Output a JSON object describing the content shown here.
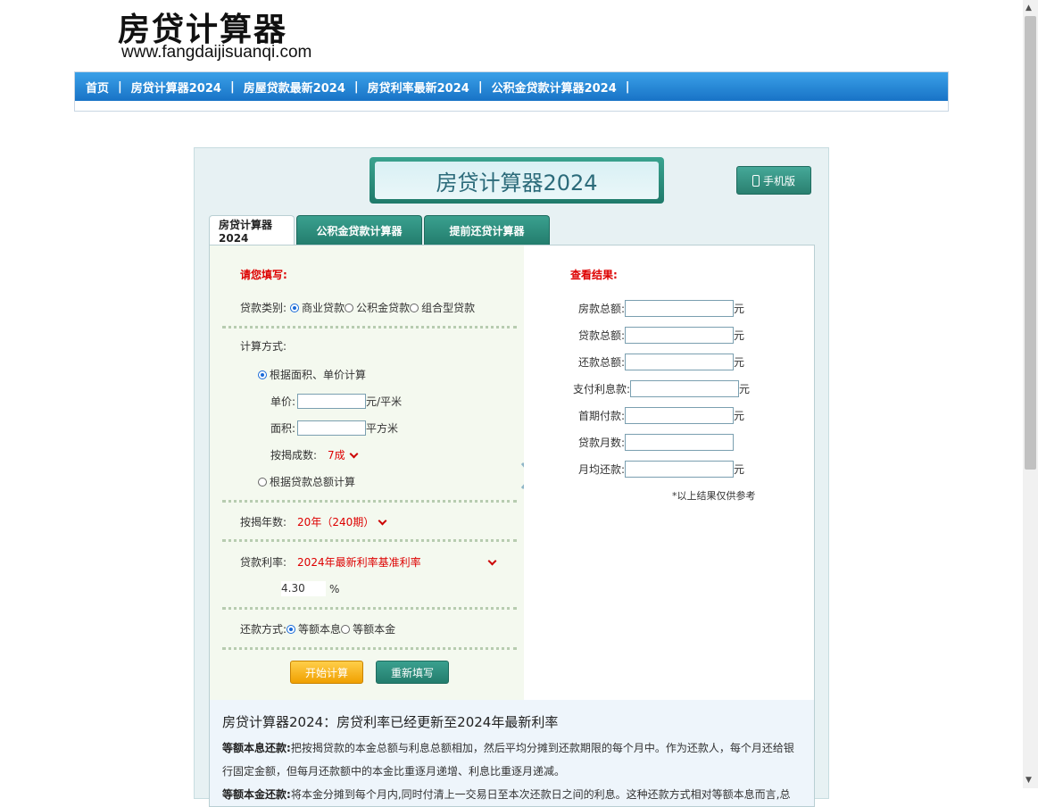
{
  "site": {
    "title": "房贷计算器",
    "url": "www.fangdaijisuanqi.com"
  },
  "nav": {
    "items": [
      {
        "label": "首页"
      },
      {
        "label": "房贷计算器2024"
      },
      {
        "label": "房屋贷款最新2024"
      },
      {
        "label": "房贷利率最新2024"
      },
      {
        "label": "公积金贷款计算器2024"
      }
    ],
    "separator": "|"
  },
  "calculator": {
    "banner": "房贷计算器2024",
    "mobile_button": "手机版",
    "tabs": [
      {
        "label": "房贷计算器2024",
        "active": true
      },
      {
        "label": "公积金贷款计算器",
        "active": false
      },
      {
        "label": "提前还贷计算器",
        "active": false
      }
    ],
    "form": {
      "heading": "请您填写:",
      "loan_type_label": "贷款类别:",
      "loan_types": [
        "商业贷款",
        "公积金贷款",
        "组合型贷款"
      ],
      "method_label": "计算方式:",
      "method_area": "根据面积、单价计算",
      "unit_price_label": "单价:",
      "unit_price_unit": "元/平米",
      "area_label": "面积:",
      "area_unit": "平方米",
      "ratio_label": "按揭成数:",
      "ratio_value": "7成",
      "method_total": "根据贷款总额计算",
      "years_label": "按揭年数:",
      "years_value": "20年（240期）",
      "rate_label": "贷款利率:",
      "rate_value": "2024年最新利率基准利率",
      "rate_number": "4.30",
      "rate_percent": "%",
      "repay_label": "还款方式:",
      "repay_options": [
        "等额本息",
        "等额本金"
      ],
      "start_button": "开始计算",
      "reset_button": "重新填写"
    },
    "results": {
      "heading": "查看结果:",
      "fields": [
        {
          "label": "房款总额:",
          "unit": "元"
        },
        {
          "label": "贷款总额:",
          "unit": "元"
        },
        {
          "label": "还款总额:",
          "unit": "元"
        },
        {
          "label": "支付利息款:",
          "unit": "元"
        },
        {
          "label": "首期付款:",
          "unit": "元"
        },
        {
          "label": "贷款月数:",
          "unit": ""
        },
        {
          "label": "月均还款:",
          "unit": "元"
        }
      ],
      "note": "*以上结果仅供参考"
    },
    "info": {
      "title": "房贷计算器2024：房贷利率已经更新至2024年最新利率",
      "p1_label": "等额本息还款:",
      "p1_text": "把按揭贷款的本金总额与利息总额相加，然后平均分摊到还款期限的每个月中。作为还款人，每个月还给银行固定金额，但每月还款额中的本金比重逐月递增、利息比重逐月递减。",
      "p2_label": "等额本金还款:",
      "p2_text": "将本金分摊到每个月内,同时付清上一交易日至本次还款日之间的利息。这种还款方式相对等额本息而言,总"
    }
  }
}
